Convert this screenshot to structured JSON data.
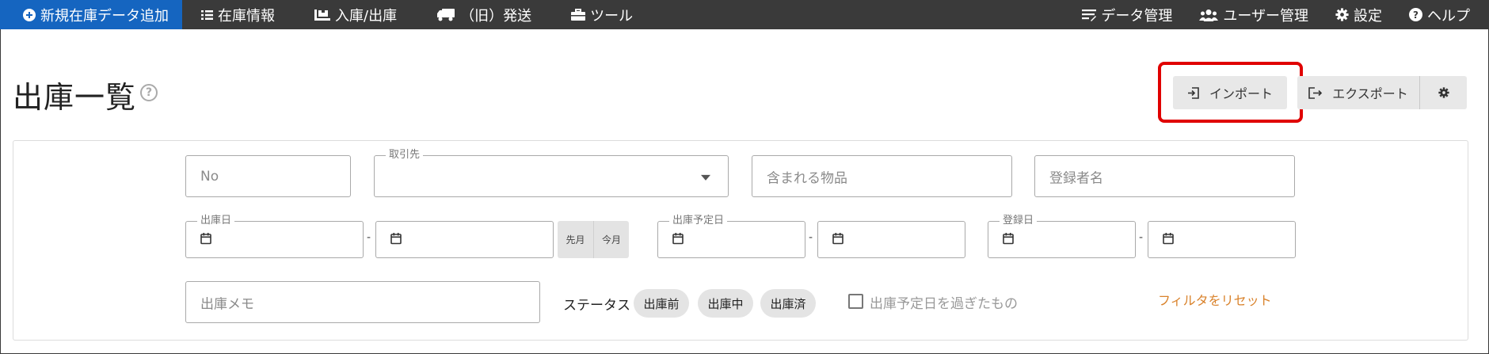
{
  "nav": {
    "new_item": "新規在庫データ追加",
    "stock_info": "在庫情報",
    "in_out": "入庫/出庫",
    "old_shipping": "（旧）発送",
    "tools": "ツール",
    "data_mgmt": "データ管理",
    "user_mgmt": "ユーザー管理",
    "settings": "設定",
    "help": "ヘルプ"
  },
  "header": {
    "title": "出庫一覧",
    "help_glyph": "?",
    "import_label": "インポート",
    "export_label": "エクスポート"
  },
  "filters": {
    "no_placeholder": "No",
    "partner_label": "取引先",
    "items_placeholder": "含まれる物品",
    "registrant_placeholder": "登録者名",
    "ship_date_label": "出庫日",
    "scheduled_date_label": "出庫予定日",
    "registered_date_label": "登録日",
    "range_separator": "-",
    "last_month": "先月",
    "this_month": "今月",
    "memo_placeholder": "出庫メモ",
    "status_label": "ステータス",
    "status_chips": [
      "出庫前",
      "出庫中",
      "出庫済"
    ],
    "overdue_label": "出庫予定日を過ぎたもの",
    "reset_label": "フィルタをリセット"
  },
  "colors": {
    "nav_bg": "#3a3a3a",
    "nav_primary": "#1565c0",
    "highlight": "#e00000",
    "reset_link": "#d9822b"
  }
}
